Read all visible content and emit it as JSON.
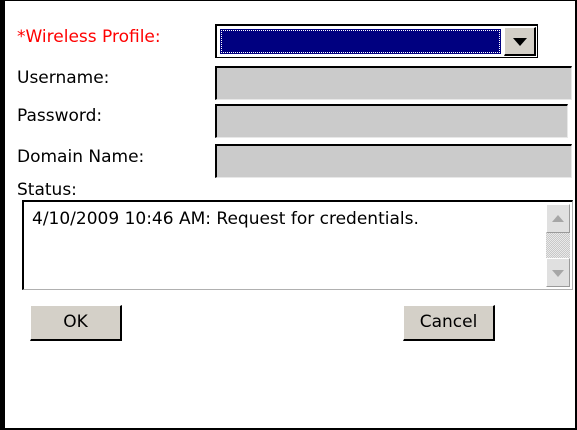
{
  "labels": {
    "wireless_profile": "*Wireless Profile:",
    "username": "Username:",
    "password": "Password:",
    "domain_name": "Domain Name:",
    "status": "Status:"
  },
  "fields": {
    "wireless_profile_value": "",
    "username_value": "",
    "password_value": "",
    "domain_name_value": ""
  },
  "status_text": "4/10/2009 10:46 AM: Request for credentials.",
  "buttons": {
    "ok": "OK",
    "cancel": "Cancel"
  },
  "colors": {
    "required_label": "#ff0000",
    "selection": "#000080",
    "disabled_field": "#cbcbcb",
    "button_face": "#d4d0c8"
  },
  "icons": {
    "combo_arrow": "chevron-down-icon",
    "scroll_up": "scroll-up-arrow-icon",
    "scroll_down": "scroll-down-arrow-icon"
  }
}
